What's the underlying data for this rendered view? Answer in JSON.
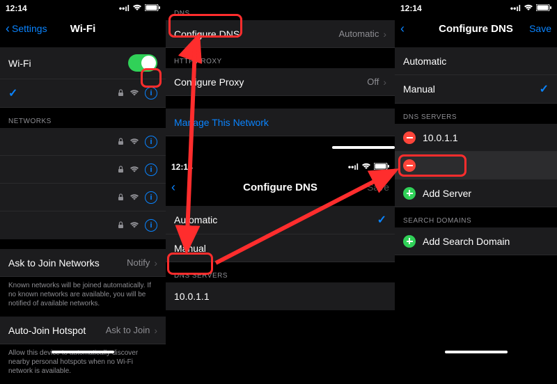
{
  "status": {
    "time": "12:14",
    "arrow_glyph": "➤"
  },
  "panel1": {
    "back": "Settings",
    "title": "Wi-Fi",
    "wifi_label": "Wi-Fi",
    "networks_hdr": "NETWORKS",
    "ask_join": "Ask to Join Networks",
    "ask_join_val": "Notify",
    "ask_join_note": "Known networks will be joined automatically. If no known networks are available, you will be notified of available networks.",
    "auto_hotspot": "Auto-Join Hotspot",
    "auto_hotspot_val": "Ask to Join",
    "auto_hotspot_note": "Allow this device to automatically discover nearby personal hotspots when no Wi-Fi network is available."
  },
  "panel2a": {
    "dns_hdr": "DNS",
    "configure_dns": "Configure DNS",
    "configure_dns_val": "Automatic",
    "proxy_hdr": "HTTP PROXY",
    "configure_proxy": "Configure Proxy",
    "configure_proxy_val": "Off",
    "manage": "Manage This Network"
  },
  "panel2b": {
    "title": "Configure DNS",
    "save": "Save",
    "automatic": "Automatic",
    "manual": "Manual",
    "dns_servers_hdr": "DNS SERVERS",
    "server1": "10.0.1.1"
  },
  "panel3": {
    "title": "Configure DNS",
    "save": "Save",
    "automatic": "Automatic",
    "manual": "Manual",
    "dns_servers_hdr": "DNS SERVERS",
    "server1": "10.0.1.1",
    "add_server": "Add Server",
    "search_domains_hdr": "SEARCH DOMAINS",
    "add_search_domain": "Add Search Domain"
  }
}
